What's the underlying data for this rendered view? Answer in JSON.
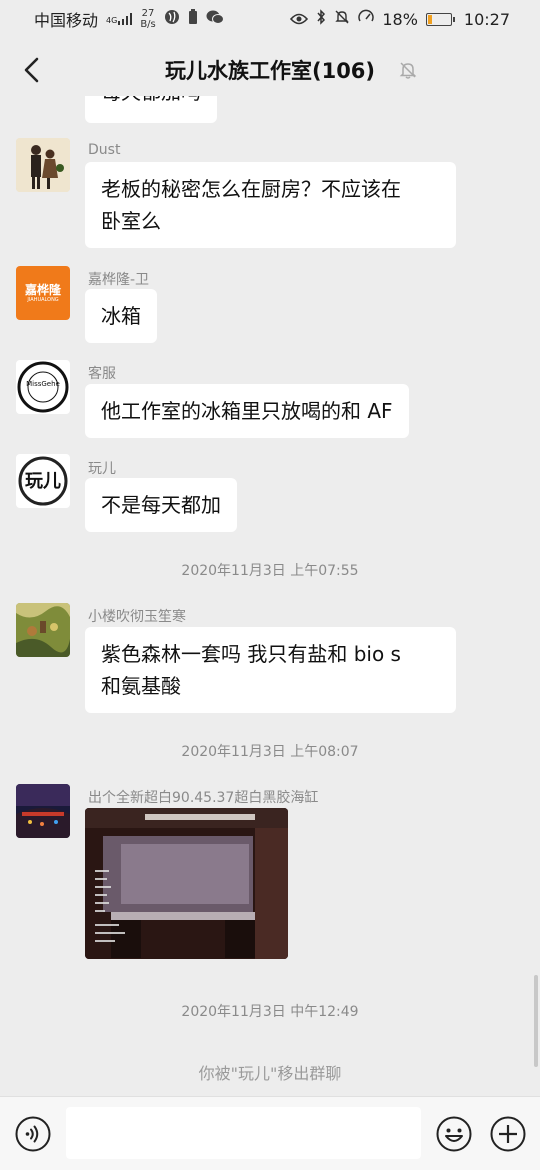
{
  "status_bar": {
    "carrier": "中国移动",
    "network": "4G",
    "speed_value": "27",
    "speed_unit": "B/s",
    "battery": "18%",
    "battery_level": 0.18,
    "time": "10:27"
  },
  "header": {
    "title": "玩儿水族工作室(106)"
  },
  "messages": [
    {
      "sender": "",
      "text": "每天都加吗"
    },
    {
      "sender": "Dust",
      "lines": [
        "老板的秘密怎么在厨房？不应该在",
        "卧室么"
      ]
    },
    {
      "sender": "嘉桦隆-卫",
      "text": "冰箱",
      "avatar_text": "嘉桦隆",
      "avatar_sub": "JIAHUALONG"
    },
    {
      "sender": "客服",
      "text": "他工作室的冰箱里只放喝的和 AF",
      "avatar_text": "MissGehe"
    },
    {
      "sender": "玩儿",
      "text": "不是每天都加",
      "avatar_text": "玩儿"
    },
    {
      "sender": "小楼吹彻玉笙寒",
      "lines": [
        "紫色森林一套吗 我只有盐和 bio s",
        "和氨基酸"
      ]
    },
    {
      "sender": "出个全新超白90.45.37超白黑胶海缸",
      "image": "aquarium-photo"
    }
  ],
  "timestamps": [
    "2020年11月3日 上午07:55",
    "2020年11月3日 上午08:07",
    "2020年11月3日 中午12:49"
  ],
  "system_message": "你被\"玩儿\"移出群聊",
  "icons": {
    "back": "chevron-left-icon",
    "mute": "bell-off-icon",
    "voice": "voice-icon",
    "emoji": "emoji-icon",
    "plus": "plus-icon"
  }
}
